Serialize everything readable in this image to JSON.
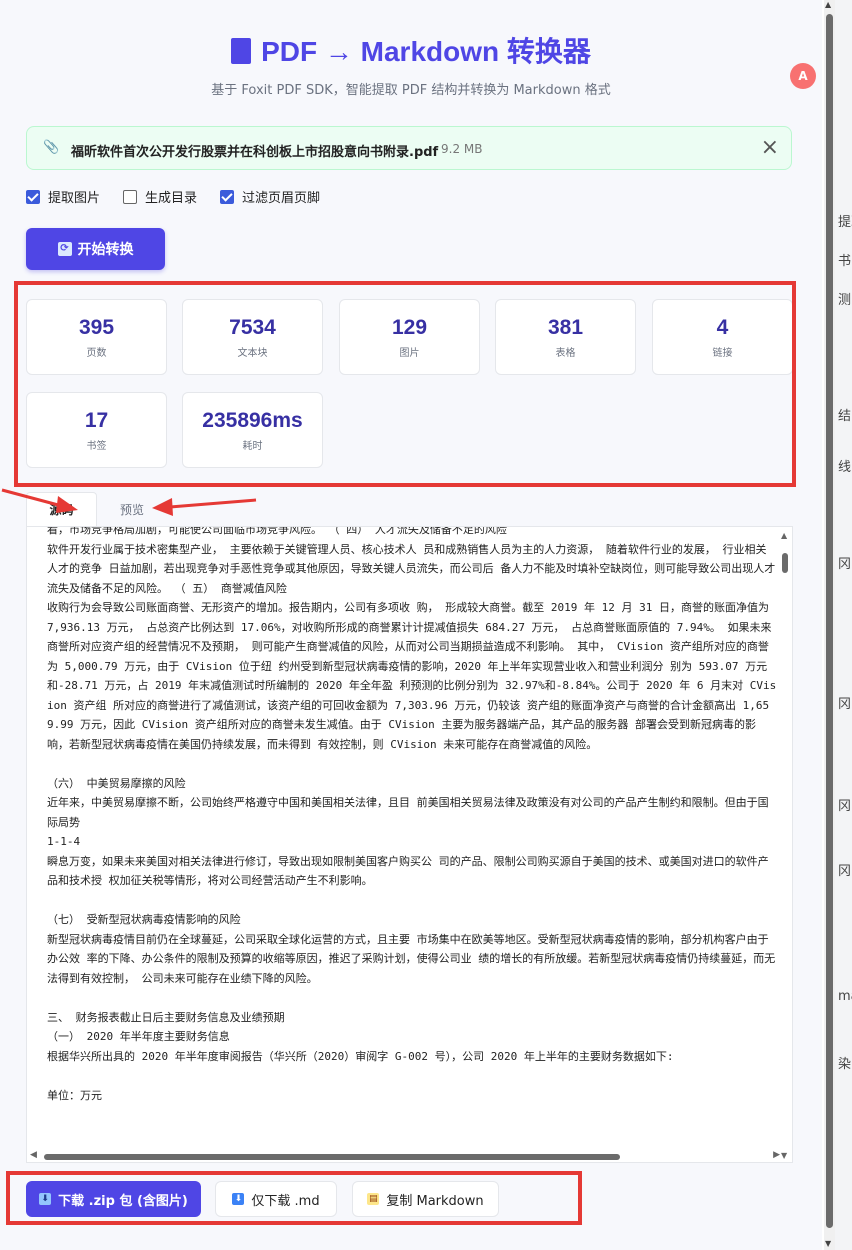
{
  "header": {
    "title": "PDF → Markdown 转换器",
    "subtitle": "基于 Foxit PDF SDK，智能提取 PDF 结构并转换为 Markdown 格式",
    "file_icon": "file-icon"
  },
  "file": {
    "name": "福昕软件首次公开发行股票并在科创板上市招股意向书附录.pdf",
    "size": "9.2 MB"
  },
  "options": [
    {
      "label": "提取图片",
      "checked": true
    },
    {
      "label": "生成目录",
      "checked": false
    },
    {
      "label": "过滤页眉页脚",
      "checked": true
    }
  ],
  "convert_button": "开始转换",
  "stats": [
    {
      "value": "395",
      "label": "页数"
    },
    {
      "value": "7534",
      "label": "文本块"
    },
    {
      "value": "129",
      "label": "图片"
    },
    {
      "value": "381",
      "label": "表格"
    },
    {
      "value": "4",
      "label": "链接"
    },
    {
      "value": "17",
      "label": "书签"
    },
    {
      "value": "235896ms",
      "label": "耗时"
    }
  ],
  "tabs": [
    {
      "label": "源码",
      "active": true
    },
    {
      "label": "预览",
      "active": false
    }
  ],
  "source_text": "看，市场竞争格局加剧，可能使公司面临市场竞争风险。 （ 四） 人才流失及储备不足的风险\n软件开发行业属于技术密集型产业， 主要依赖于关键管理人员、核心技术人 员和成熟销售人员为主的人力资源， 随着软件行业的发展， 行业相关人才的竞争 日益加剧，若出现竞争对手恶性竞争或其他原因，导致关键人员流失，而公司后 备人力不能及时填补空缺岗位，则可能导致公司出现人才流失及储备不足的风险。 （ 五） 商誉减值风险\n收购行为会导致公司账面商誉、无形资产的增加。报告期内，公司有多项收 购， 形成较大商誉。截至 2019 年 12 月 31 日，商誉的账面净值为 7,936.13 万元， 占总资产比例达到 17.06%，对收购所形成的商誉累计计提减值损失 684.27 万元， 占总商誉账面原值的 7.94%。 如果未来商誉所对应资产组的经营情况不及预期， 则可能产生商誉减值的风险，从而对公司当期损益造成不利影响。 其中， CVision 资产组所对应的商誉为 5,000.79 万元，由于 CVision 位于纽 约州受到新型冠状病毒疫情的影响，2020 年上半年实现营业收入和营业利润分 别为 593.07 万元和-28.71 万元，占 2019 年末减值测试时所编制的 2020 年全年盈 利预测的比例分别为 32.97%和-8.84%。公司于 2020 年 6 月末对 CVision 资产组 所对应的商誉进行了减值测试，该资产组的可回收金额为 7,303.96 万元，仍较该 资产组的账面净资产与商誉的合计金额高出 1,659.99 万元，因此 CVision 资产组所对应的商誉未发生减值。由于 CVision 主要为服务器端产品，其产品的服务器 部署会受到新冠病毒的影响，若新型冠状病毒疫情在美国仍持续发展，而未得到 有效控制，则 CVision 未来可能存在商誉减值的风险。\n\n（六） 中美贸易摩擦的风险\n近年来，中美贸易摩擦不断，公司始终严格遵守中国和美国相关法律，且目 前美国相关贸易法律及政策没有对公司的产品产生制约和限制。但由于国际局势\n1-1-4\n瞬息万变，如果未来美国对相关法律进行修订，导致出现如限制美国客户购买公 司的产品、限制公司购买源自于美国的技术、或美国对进口的软件产品和技术授 权加征关税等情形，将对公司经营活动产生不利影响。\n\n（七） 受新型冠状病毒疫情影响的风险\n新型冠状病毒疫情目前仍在全球蔓延，公司采取全球化运营的方式，且主要 市场集中在欧美等地区。受新型冠状病毒疫情的影响，部分机构客户由于办公效 率的下降、办公条件的限制及预算的收缩等原因，推迟了采购计划，使得公司业 绩的增长的有所放缓。若新型冠状病毒疫情仍持续蔓延，而无法得到有效控制， 公司未来可能存在业绩下降的风险。\n\n三、 财务报表截止日后主要财务信息及业绩预期\n（一） 2020 年半年度主要财务信息\n根据华兴所出具的 2020 年半年度审阅报告（华兴所（2020）审阅字 G-002 号），公司 2020 年上半年的主要财务数据如下:\n\n单位：万元",
  "download_buttons": [
    {
      "label": "下载 .zip 包 (含图片)",
      "icon": "download-icon"
    },
    {
      "label": "仅下载 .md",
      "icon": "download-icon"
    },
    {
      "label": "复制 Markdown",
      "icon": "clipboard-icon"
    }
  ],
  "side_fragments": [
    "提耳",
    "书",
    "测",
    "结",
    "线",
    "冈",
    "冈",
    "冈",
    "冈",
    "ma",
    "染"
  ],
  "colors": {
    "accent": "#4f46e5",
    "highlight": "#e53935",
    "success_bg": "#ecfdf3"
  }
}
